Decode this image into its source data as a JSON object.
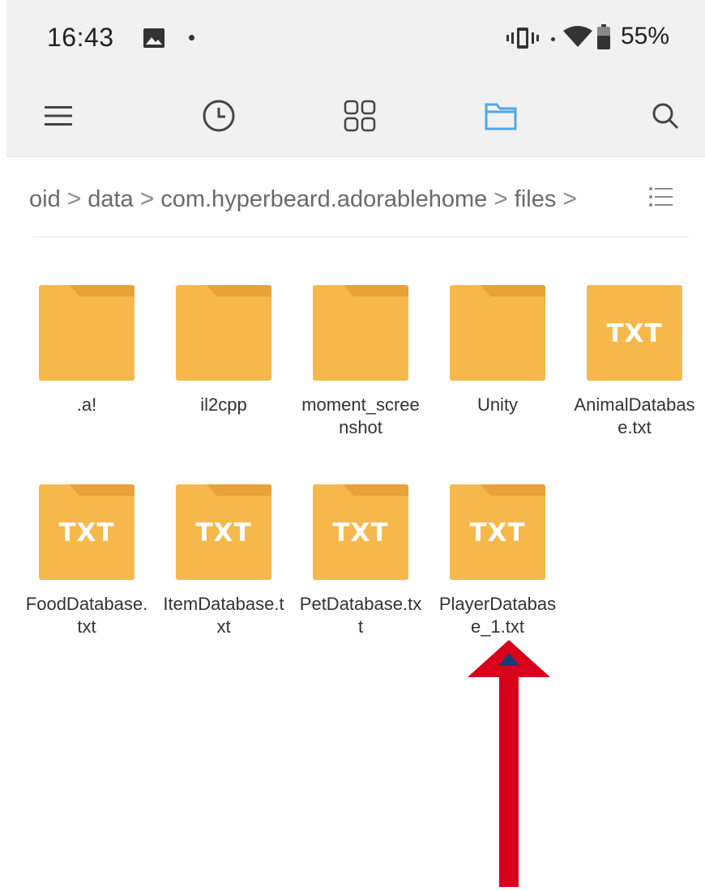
{
  "status_bar": {
    "time": "16:43",
    "battery_percent": "55%",
    "icons": [
      "gallery-icon",
      "vibrate-icon",
      "wifi-icon",
      "battery-icon"
    ]
  },
  "toolbar": {
    "buttons": [
      "menu-icon",
      "recent-icon",
      "categories-icon",
      "folder-icon",
      "search-icon"
    ],
    "active": "folder-icon",
    "accent": "#4fa7e8"
  },
  "breadcrumb": {
    "items": [
      "oid",
      "data",
      "com.hyperbeard.adorablehome",
      "files"
    ],
    "separator": ">"
  },
  "files": [
    {
      "name": ".a!",
      "type": "folder"
    },
    {
      "name": "il2cpp",
      "type": "folder"
    },
    {
      "name": "moment_screenshot",
      "type": "folder"
    },
    {
      "name": "Unity",
      "type": "folder"
    },
    {
      "name": "AnimalDatabase.txt",
      "type": "txt",
      "badge": "TXT"
    },
    {
      "name": "FoodDatabase.txt",
      "type": "txt",
      "badge": "TXT"
    },
    {
      "name": "ItemDatabase.txt",
      "type": "txt",
      "badge": "TXT"
    },
    {
      "name": "PetDatabase.txt",
      "type": "txt",
      "badge": "TXT"
    },
    {
      "name": "PlayerDatabase_1.txt",
      "type": "txt",
      "badge": "TXT"
    }
  ],
  "colors": {
    "folder": "#f7b84b",
    "folder_tab": "#e8a238",
    "annotation_arrow": "#d9001b"
  }
}
